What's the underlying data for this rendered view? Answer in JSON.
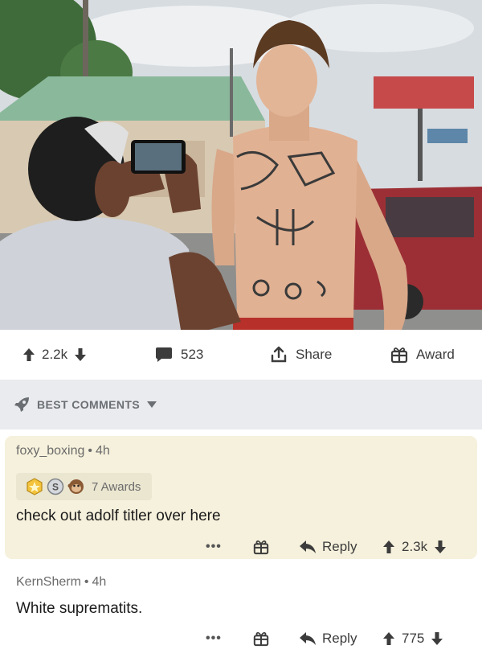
{
  "post": {
    "image_subject": "shirtless tattooed man being photographed by a woman with a phone",
    "upvotes": "2.2k",
    "comment_count": "523",
    "share_label": "Share",
    "award_label": "Award"
  },
  "sort": {
    "label": "BEST COMMENTS"
  },
  "comments": [
    {
      "author": "foxy_boxing",
      "time": "4h",
      "awards_label": "7 Awards",
      "body": "check out adolf titler over here",
      "more": "•••",
      "reply_label": "Reply",
      "votes": "2.3k"
    },
    {
      "author": "KernSherm",
      "time": "4h",
      "body": "White suprematits.",
      "more": "•••",
      "reply_label": "Reply",
      "votes": "775"
    }
  ],
  "colors": {
    "highlight_comment_bg": "#f6f1dc",
    "sort_bar_bg": "#e9ebee",
    "icon": "#3c3c3c",
    "meta_text": "#6b6b6b"
  }
}
